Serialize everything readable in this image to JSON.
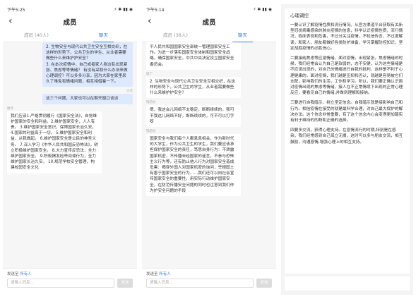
{
  "phones": [
    {
      "status_time": "下午5:25",
      "status_right": "⚡ ✱ ▮▮ ◉",
      "title": "成员",
      "tabs": [
        "成员 (40人)",
        "聊天"
      ],
      "active_tab": 1,
      "messages": [
        {
          "dir": "out",
          "meta": "",
          "text": "2. 生物安全与现代公共卫生安全互相交织，在这样的形势下，公共卫生的学生、从业者需要做些什么来维护护安全？\n3. 在本次疫情中，自己或者家人身边有出现紧张、焦虑等等情绪？ 有没有采取什么办法来做心理调控？可以多多分享，因为大家在家里呆久了难免有情绪问题，相互相借鉴一下。"
        },
        {
          "dir": "out",
          "meta": "沙老",
          "text": "这三个问题，大家也可以在聊天窗口谈谈"
        },
        {
          "dir": "in",
          "meta": "唐玲",
          "text": "我们应该1.严格贯彻履行《国家安全法》，自觉维护国家的安全和利益。2.维护国家安全，人人有责。      3.维护国家安全意识，保障国家长治久安。     4.国家的利益高于一切。     5.维护国家安全和利益，从我做起。   6.维护国家安全是公民的神圣义务。               7.深入学习《中华人民共和国反恐怖法》，树立积极维护国家安全。         8.大力宣传反恐法，全力维护国家安全。      9.积极揭发检举间谍行为，全力维护国家长治久安。    10.规范学校安全管理，构建校园安全文化"
        }
      ],
      "send_to_label": "发送至",
      "send_to_value": "所有人",
      "input_placeholder": "请输入消息...",
      "send_label": "发送"
    },
    {
      "status_time": "下午5:14",
      "status_right": "⚡ ✱ ▮▮ ◉",
      "title": "成员",
      "tabs": [
        "成员 (38人)",
        "聊天"
      ],
      "active_tab": 1,
      "messages": [
        {
          "dir": "in",
          "meta": "",
          "text": "平人民共和国国家安全部统一管理国家安全工作。为进一步落实国家安全体制和国家安全战略，确保国家安全，中共中央决定设立国家安全委员会。"
        },
        {
          "dir": "in",
          "meta": "唐广",
          "text": "2. 生物安全与现代公共卫生安全互相交织，在这样的形势下，公共卫生的学生，从业者需要做些什么来维护护安全？"
        },
        {
          "dir": "in",
          "meta": "钱韵达",
          "text": "嗯，我这会儿网络不太稳定，断断续续的，我可不我这儿网络不好，断断续续的，可不可以打字呀"
        },
        {
          "dir": "in",
          "meta": "钱韵达",
          "text": "国家安全与我们每个人都息息相关，作为新时代的大学生，作为公共卫生的学生，我们要应该承担保护国家安全的责任，笃思自身行为：不泄露国家机密，不传播未经国家的谣言，不参与恐怖主义行为等，还有防止他人行为对国家安全造成危害：揭穿外国人对国家机密的询问，举报国土有害于国家安全的行为……我们还可以向社会宣传国家安全的重要性，用实际行动维护国家安全，在防范传播安全问题的同时也注意到我们作为护安全问题的手段"
        }
      ],
      "send_to_label": "发送至",
      "send_to_value": "所有人",
      "input_placeholder": "请输入消息...",
      "send_label": "发送"
    }
  ],
  "panel": {
    "title": "心理调控",
    "paragraphs": [
      "一要认识了解疫情性质和流行情况。从官方渠道平台获取有关新型冠状病毒感染的肺炎疫情的信息，科学认识疫情性质，流行情况，临床表现和危害，不过分关注疫情，不轻信传言，不过度解读，和家人、朋友都做好各类防护准备，学习掌握防控知识，坚定战胜疫情的必胜信心。",
      "二要接纳焦虑等应激情绪。面对疫情，出现紧张，焦虑情绪的时候，我们经常会认为自己是软弱的，态不安健，认为这些情绪是不应该出现的，对自己的情绪进行自我的批判，这样是不利于心理健康的。面对疫情，我们越是压抑和否认，就越是容易被它们支配，影响我们的生活，工作和学习。所以，我们要正确认识面对疫情出现的焦虑等情绪，接人在不正常情境下出现的正常心理反应，要看见自己的情绪,并做到理解和接纳。",
      "三要进行自我暗示，树立坚定信念。自我暗示就是接影响自己和行为。相信疫情在接受的就是最科学合理，对自己最大保护的解决办法。这个信念非常重要，有了这个信念内心会变得更加踏实有利于维持的的断和正确的选择。",
      "四要多交流，获得心理支持。在疫情流行的时期,特别是在感染，我们经常感到自己孤立无援，这时可以多与朋友交流，相互鼓励，沟通感情,增强心理上的相互支持。"
    ]
  }
}
